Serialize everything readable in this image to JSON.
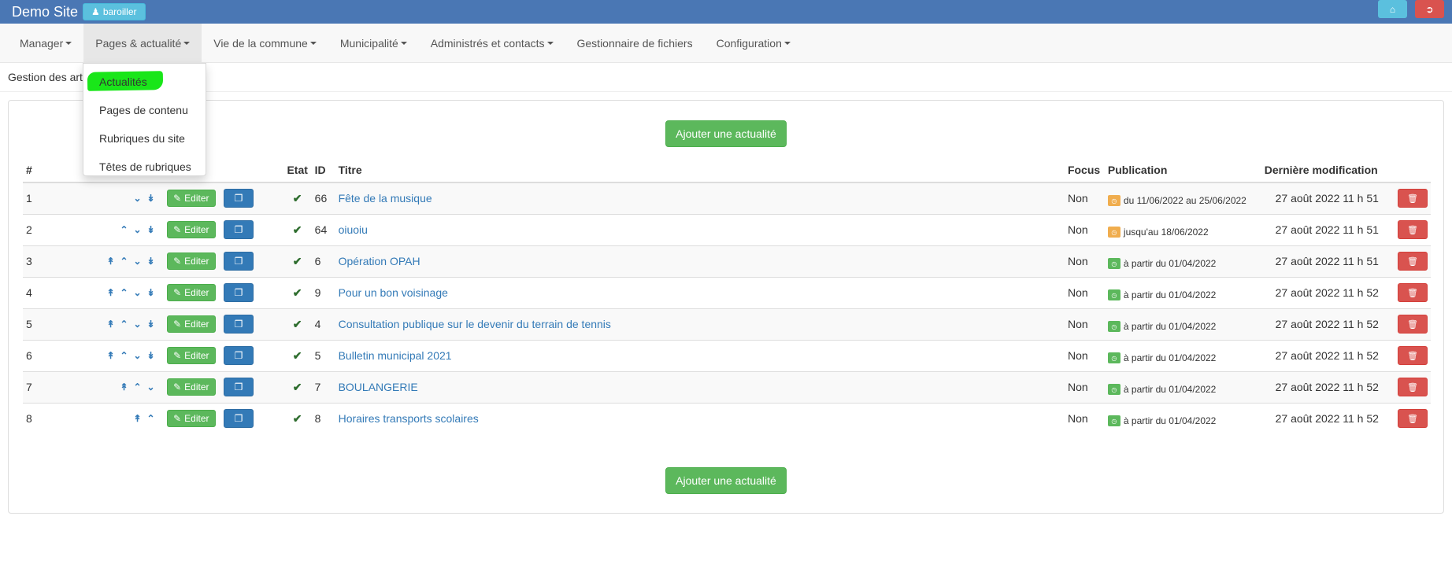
{
  "topbar": {
    "site_name": "Demo Site",
    "user_label": "baroiller",
    "user_icon": "user-icon",
    "home_icon": "home-icon",
    "logout_icon": "sign-out-icon"
  },
  "nav": {
    "items": [
      {
        "label": "Manager",
        "has_caret": true
      },
      {
        "label": "Pages & actualité",
        "has_caret": true
      },
      {
        "label": "Vie de la commune",
        "has_caret": true
      },
      {
        "label": "Municipalité",
        "has_caret": true
      },
      {
        "label": "Administrés et contacts",
        "has_caret": true
      },
      {
        "label": "Gestionnaire de fichiers",
        "has_caret": false
      },
      {
        "label": "Configuration",
        "has_caret": true
      }
    ]
  },
  "breadcrumb": "Gestion des art",
  "dropdown": {
    "items": [
      "Actualités",
      "Pages de contenu",
      "Rubriques du site",
      "Têtes de rubriques"
    ],
    "highlight_color": "#19e619"
  },
  "add_button": "Ajouter une actualité",
  "table": {
    "headers": {
      "num": "#",
      "state": "Etat",
      "id": "ID",
      "title": "Titre",
      "focus": "Focus",
      "publication": "Publication",
      "modified": "Dernière modification"
    },
    "edit_label": "Editer",
    "rows": [
      {
        "num": "1",
        "id": "66",
        "title": "Fête de la musique",
        "focus": "Non",
        "pub": "du 11/06/2022 au 25/06/2022",
        "pub_color": "orange",
        "modified": "27 août 2022 11 h 51",
        "arrows": [
          "down",
          "bottom"
        ]
      },
      {
        "num": "2",
        "id": "64",
        "title": "oiuoiu",
        "focus": "Non",
        "pub": "jusqu'au 18/06/2022",
        "pub_color": "orange",
        "modified": "27 août 2022 11 h 51",
        "arrows": [
          "up",
          "down",
          "bottom"
        ]
      },
      {
        "num": "3",
        "id": "6",
        "title": "Opération OPAH",
        "focus": "Non",
        "pub": "à partir du 01/04/2022",
        "pub_color": "green",
        "modified": "27 août 2022 11 h 51",
        "arrows": [
          "top",
          "up",
          "down",
          "bottom"
        ]
      },
      {
        "num": "4",
        "id": "9",
        "title": "Pour un bon voisinage",
        "focus": "Non",
        "pub": "à partir du 01/04/2022",
        "pub_color": "green",
        "modified": "27 août 2022 11 h 52",
        "arrows": [
          "top",
          "up",
          "down",
          "bottom"
        ]
      },
      {
        "num": "5",
        "id": "4",
        "title": "Consultation publique sur le devenir du terrain de tennis",
        "focus": "Non",
        "pub": "à partir du 01/04/2022",
        "pub_color": "green",
        "modified": "27 août 2022 11 h 52",
        "arrows": [
          "top",
          "up",
          "down",
          "bottom"
        ]
      },
      {
        "num": "6",
        "id": "5",
        "title": "Bulletin municipal 2021",
        "focus": "Non",
        "pub": "à partir du 01/04/2022",
        "pub_color": "green",
        "modified": "27 août 2022 11 h 52",
        "arrows": [
          "top",
          "up",
          "down",
          "bottom"
        ]
      },
      {
        "num": "7",
        "id": "7",
        "title": "BOULANGERIE",
        "focus": "Non",
        "pub": "à partir du 01/04/2022",
        "pub_color": "green",
        "modified": "27 août 2022 11 h 52",
        "arrows": [
          "top",
          "up",
          "down"
        ]
      },
      {
        "num": "8",
        "id": "8",
        "title": "Horaires transports scolaires",
        "focus": "Non",
        "pub": "à partir du 01/04/2022",
        "pub_color": "green",
        "modified": "27 août 2022 11 h 52",
        "arrows": [
          "top",
          "up"
        ]
      }
    ]
  }
}
